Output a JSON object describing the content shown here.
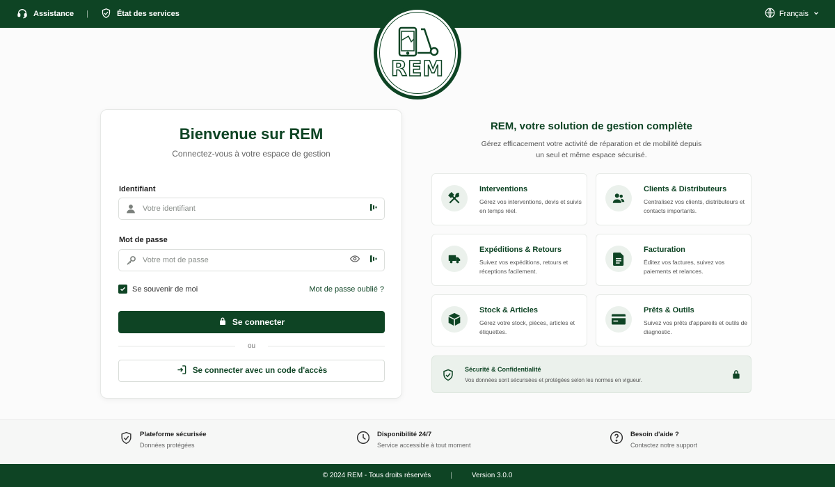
{
  "topbar": {
    "assistance": "Assistance",
    "status": "État des services",
    "language": "Français"
  },
  "logo": {
    "text": "REM"
  },
  "login": {
    "title": "Bienvenue sur REM",
    "subtitle": "Connectez-vous à votre espace de gestion",
    "username_label": "Identifiant",
    "username_placeholder": "Votre identifiant",
    "password_label": "Mot de passe",
    "password_placeholder": "Votre mot de passe",
    "remember_label": "Se souvenir de moi",
    "remember_checked": true,
    "forgot_label": "Mot de passe oublié ?",
    "submit_label": "Se connecter",
    "or_label": "ou",
    "access_code_label": "Se connecter avec un code d'accès"
  },
  "promo": {
    "title": "REM, votre solution de gestion complète",
    "description": "Gérez efficacement votre activité de réparation et de mobilité depuis un seul et même espace sécurisé.",
    "features": [
      {
        "icon": "tools-icon",
        "title": "Interventions",
        "description": "Gérez vos interventions, devis et suivis en temps réel."
      },
      {
        "icon": "users-icon",
        "title": "Clients & Distributeurs",
        "description": "Centralisez vos clients, distributeurs et contacts importants."
      },
      {
        "icon": "truck-icon",
        "title": "Expéditions & Retours",
        "description": "Suivez vos expéditions, retours et réceptions facilement."
      },
      {
        "icon": "invoice-icon",
        "title": "Facturation",
        "description": "Éditez vos factures, suivez vos paiements et relances."
      },
      {
        "icon": "box-icon",
        "title": "Stock & Articles",
        "description": "Gérez votre stock, pièces, articles et étiquettes."
      },
      {
        "icon": "card-icon",
        "title": "Prêts & Outils",
        "description": "Suivez vos prêts d'appareils et outils de diagnostic."
      }
    ],
    "security": {
      "title": "Sécurité & Confidentialité",
      "description": "Vos données sont sécurisées et protégées selon les normes en vigueur."
    }
  },
  "info": [
    {
      "title": "Plateforme sécurisée",
      "description": "Données protégées"
    },
    {
      "title": "Disponibilité 24/7",
      "description": "Service accessible à tout moment"
    },
    {
      "title": "Besoin d'aide ?",
      "description": "Contactez notre support"
    }
  ],
  "footer": {
    "copyright": "© 2024 REM - Tous droits réservés",
    "version": "Version 3.0.0"
  },
  "colors": {
    "brand": "#0e4424",
    "icon_bg": "#ebf1ec"
  }
}
